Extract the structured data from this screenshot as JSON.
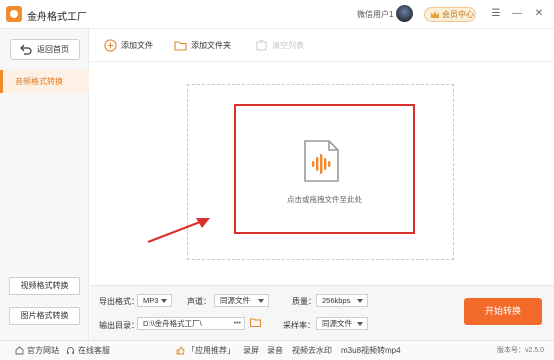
{
  "app": {
    "title": "金舟格式工厂",
    "user_name": "微信用户1",
    "vip_label": "会员中心"
  },
  "window_controls": [
    "☰",
    "—",
    "✕"
  ],
  "sidebar": {
    "back_label": "返回首页",
    "active_item": "音频格式转换",
    "bottom_buttons": [
      "视频格式转换",
      "图片格式转换"
    ]
  },
  "toolbar": {
    "add_file": "添加文件",
    "add_folder": "添加文件夹",
    "clear_list": "清空列表"
  },
  "dropzone": {
    "text": "点击或拖拽文件至此处"
  },
  "settings": {
    "export_format_label": "导出格式：",
    "export_format_value": "MP3",
    "channel_label": "声道：",
    "channel_value": "同源文件",
    "quality_label": "质量：",
    "quality_value": "256kbps",
    "output_dir_label": "输出目录：",
    "output_dir_value": "D:\\\\金舟格式工厂\\",
    "more_label": "•••",
    "sample_rate_label": "采样率：",
    "sample_rate_value": "同源文件",
    "start_label": "开始转换"
  },
  "statusbar": {
    "website": "官方网站",
    "support": "在线客服",
    "recommend": "「应用推荐」",
    "links": [
      "录屏",
      "录音",
      "视频去水印",
      "m3u8视频转mp4"
    ],
    "version": "版本号：v2.5.0"
  },
  "colors": {
    "accent": "#f28a2e",
    "start_button": "#f26b2a",
    "highlight_box": "#d9302b"
  }
}
